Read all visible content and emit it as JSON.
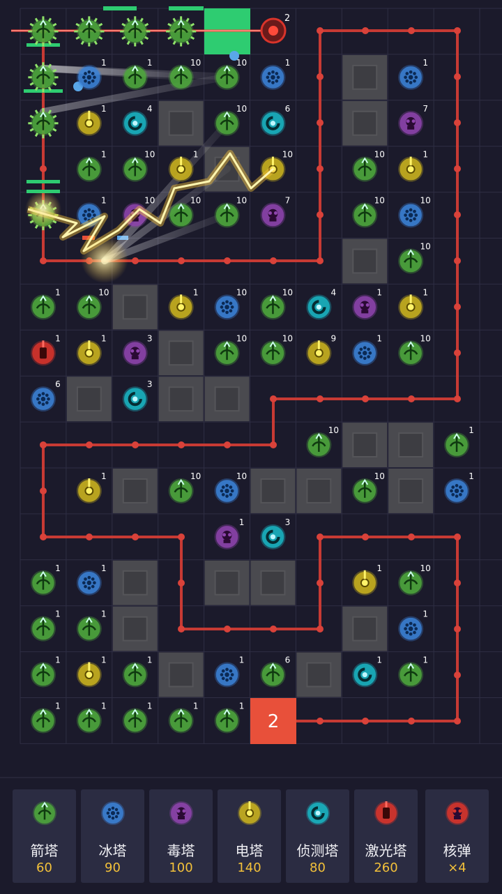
{
  "colors": {
    "arrow": "#4ea83c",
    "ice": "#3b82d6",
    "poison": "#8e44ad",
    "electric": "#c9b21e",
    "detect": "#19b5c2",
    "laser": "#d9342b",
    "path": "#c73a34",
    "block": "#4a4a4f",
    "green_marker": "#2ecc71",
    "gold": "#f3c13a"
  },
  "grid": {
    "cols": 11,
    "rows": 16
  },
  "enemy_count_label": "2",
  "laser_counter": "2",
  "towers": [
    {
      "c": 0,
      "r": 0,
      "type": "arrow_active",
      "level": ""
    },
    {
      "c": 1,
      "r": 0,
      "type": "arrow_active",
      "level": ""
    },
    {
      "c": 2,
      "r": 0,
      "type": "arrow_active",
      "level": ""
    },
    {
      "c": 3,
      "r": 0,
      "type": "arrow_active",
      "level": ""
    },
    {
      "c": 0,
      "r": 1,
      "type": "arrow_active",
      "level": ""
    },
    {
      "c": 1,
      "r": 1,
      "type": "ice",
      "level": "1"
    },
    {
      "c": 2,
      "r": 1,
      "type": "arrow",
      "level": "1"
    },
    {
      "c": 3,
      "r": 1,
      "type": "arrow",
      "level": "10"
    },
    {
      "c": 4,
      "r": 1,
      "type": "arrow",
      "level": "10"
    },
    {
      "c": 5,
      "r": 1,
      "type": "ice",
      "level": "1"
    },
    {
      "c": 8,
      "r": 1,
      "type": "ice",
      "level": "1"
    },
    {
      "c": 0,
      "r": 2,
      "type": "arrow_active",
      "level": ""
    },
    {
      "c": 1,
      "r": 2,
      "type": "electric",
      "level": "1"
    },
    {
      "c": 2,
      "r": 2,
      "type": "detect",
      "level": "4"
    },
    {
      "c": 4,
      "r": 2,
      "type": "arrow",
      "level": "10"
    },
    {
      "c": 5,
      "r": 2,
      "type": "detect",
      "level": "6"
    },
    {
      "c": 8,
      "r": 2,
      "type": "poison",
      "level": "7"
    },
    {
      "c": 1,
      "r": 3,
      "type": "arrow",
      "level": "1"
    },
    {
      "c": 2,
      "r": 3,
      "type": "arrow",
      "level": "10"
    },
    {
      "c": 3,
      "r": 3,
      "type": "electric",
      "level": "1"
    },
    {
      "c": 5,
      "r": 3,
      "type": "electric",
      "level": "10"
    },
    {
      "c": 7,
      "r": 3,
      "type": "arrow",
      "level": "10"
    },
    {
      "c": 8,
      "r": 3,
      "type": "electric",
      "level": "1"
    },
    {
      "c": 0,
      "r": 4,
      "type": "arrow_active",
      "level": ""
    },
    {
      "c": 1,
      "r": 4,
      "type": "ice",
      "level": "1"
    },
    {
      "c": 2,
      "r": 4,
      "type": "poison",
      "level": "10"
    },
    {
      "c": 3,
      "r": 4,
      "type": "arrow",
      "level": "10"
    },
    {
      "c": 4,
      "r": 4,
      "type": "arrow",
      "level": "10"
    },
    {
      "c": 5,
      "r": 4,
      "type": "poison",
      "level": "7"
    },
    {
      "c": 7,
      "r": 4,
      "type": "arrow",
      "level": "10"
    },
    {
      "c": 8,
      "r": 4,
      "type": "ice",
      "level": "10"
    },
    {
      "c": 8,
      "r": 5,
      "type": "arrow",
      "level": "10"
    },
    {
      "c": 0,
      "r": 6,
      "type": "arrow",
      "level": "1"
    },
    {
      "c": 1,
      "r": 6,
      "type": "arrow",
      "level": "10"
    },
    {
      "c": 3,
      "r": 6,
      "type": "electric",
      "level": "1"
    },
    {
      "c": 4,
      "r": 6,
      "type": "ice",
      "level": "10"
    },
    {
      "c": 5,
      "r": 6,
      "type": "arrow",
      "level": "10"
    },
    {
      "c": 6,
      "r": 6,
      "type": "detect",
      "level": "4"
    },
    {
      "c": 7,
      "r": 6,
      "type": "poison",
      "level": "1"
    },
    {
      "c": 8,
      "r": 6,
      "type": "electric",
      "level": "1"
    },
    {
      "c": 0,
      "r": 7,
      "type": "laser",
      "level": "1"
    },
    {
      "c": 1,
      "r": 7,
      "type": "electric",
      "level": "1"
    },
    {
      "c": 2,
      "r": 7,
      "type": "poison",
      "level": "3"
    },
    {
      "c": 4,
      "r": 7,
      "type": "arrow",
      "level": "10"
    },
    {
      "c": 5,
      "r": 7,
      "type": "arrow",
      "level": "10"
    },
    {
      "c": 6,
      "r": 7,
      "type": "electric",
      "level": "9"
    },
    {
      "c": 7,
      "r": 7,
      "type": "ice",
      "level": "1"
    },
    {
      "c": 8,
      "r": 7,
      "type": "arrow",
      "level": "10"
    },
    {
      "c": 0,
      "r": 8,
      "type": "ice",
      "level": "6"
    },
    {
      "c": 2,
      "r": 8,
      "type": "detect",
      "level": "3"
    },
    {
      "c": 6,
      "r": 9,
      "type": "arrow",
      "level": "10"
    },
    {
      "c": 9,
      "r": 9,
      "type": "arrow",
      "level": "1"
    },
    {
      "c": 1,
      "r": 10,
      "type": "electric",
      "level": "1"
    },
    {
      "c": 3,
      "r": 10,
      "type": "arrow",
      "level": "10"
    },
    {
      "c": 4,
      "r": 10,
      "type": "ice",
      "level": "10"
    },
    {
      "c": 7,
      "r": 10,
      "type": "arrow",
      "level": "10"
    },
    {
      "c": 9,
      "r": 10,
      "type": "ice",
      "level": "1"
    },
    {
      "c": 4,
      "r": 11,
      "type": "poison",
      "level": "1"
    },
    {
      "c": 5,
      "r": 11,
      "type": "detect",
      "level": "3"
    },
    {
      "c": 0,
      "r": 12,
      "type": "arrow",
      "level": "1"
    },
    {
      "c": 1,
      "r": 12,
      "type": "ice",
      "level": "1"
    },
    {
      "c": 7,
      "r": 12,
      "type": "electric",
      "level": "1"
    },
    {
      "c": 8,
      "r": 12,
      "type": "arrow",
      "level": "10"
    },
    {
      "c": 0,
      "r": 13,
      "type": "arrow",
      "level": "1"
    },
    {
      "c": 1,
      "r": 13,
      "type": "arrow",
      "level": "1"
    },
    {
      "c": 8,
      "r": 13,
      "type": "ice",
      "level": "1"
    },
    {
      "c": 0,
      "r": 14,
      "type": "arrow",
      "level": "1"
    },
    {
      "c": 1,
      "r": 14,
      "type": "electric",
      "level": "1"
    },
    {
      "c": 2,
      "r": 14,
      "type": "arrow",
      "level": "1"
    },
    {
      "c": 4,
      "r": 14,
      "type": "ice",
      "level": "1"
    },
    {
      "c": 5,
      "r": 14,
      "type": "arrow",
      "level": "6"
    },
    {
      "c": 7,
      "r": 14,
      "type": "detect",
      "level": "1"
    },
    {
      "c": 8,
      "r": 14,
      "type": "arrow",
      "level": "1"
    },
    {
      "c": 0,
      "r": 15,
      "type": "arrow",
      "level": "1"
    },
    {
      "c": 1,
      "r": 15,
      "type": "arrow",
      "level": "1"
    },
    {
      "c": 2,
      "r": 15,
      "type": "arrow",
      "level": "1"
    },
    {
      "c": 3,
      "r": 15,
      "type": "arrow",
      "level": "1"
    },
    {
      "c": 4,
      "r": 15,
      "type": "arrow",
      "level": "1"
    }
  ],
  "blocks": [
    {
      "c": 7,
      "r": 1
    },
    {
      "c": 3,
      "r": 2
    },
    {
      "c": 7,
      "r": 2
    },
    {
      "c": 4,
      "r": 3
    },
    {
      "c": 7,
      "r": 5
    },
    {
      "c": 2,
      "r": 6
    },
    {
      "c": 3,
      "r": 7
    },
    {
      "c": 1,
      "r": 8
    },
    {
      "c": 3,
      "r": 8
    },
    {
      "c": 4,
      "r": 8
    },
    {
      "c": 7,
      "r": 9
    },
    {
      "c": 8,
      "r": 9
    },
    {
      "c": 2,
      "r": 10
    },
    {
      "c": 5,
      "r": 10
    },
    {
      "c": 6,
      "r": 10
    },
    {
      "c": 8,
      "r": 10
    },
    {
      "c": 2,
      "r": 12
    },
    {
      "c": 4,
      "r": 12
    },
    {
      "c": 5,
      "r": 12
    },
    {
      "c": 2,
      "r": 13
    },
    {
      "c": 7,
      "r": 13
    },
    {
      "c": 3,
      "r": 14
    },
    {
      "c": 6,
      "r": 14
    }
  ],
  "shop": [
    {
      "type": "arrow",
      "name": "箭塔",
      "cost": "60"
    },
    {
      "type": "ice",
      "name": "冰塔",
      "cost": "90"
    },
    {
      "type": "poison",
      "name": "毒塔",
      "cost": "100"
    },
    {
      "type": "electric",
      "name": "电塔",
      "cost": "140"
    },
    {
      "type": "detect",
      "name": "侦测塔",
      "cost": "80"
    },
    {
      "type": "laser",
      "name": "激光塔",
      "cost": "260"
    },
    {
      "type": "nuke",
      "name": "核弹",
      "cost": "×4"
    }
  ]
}
